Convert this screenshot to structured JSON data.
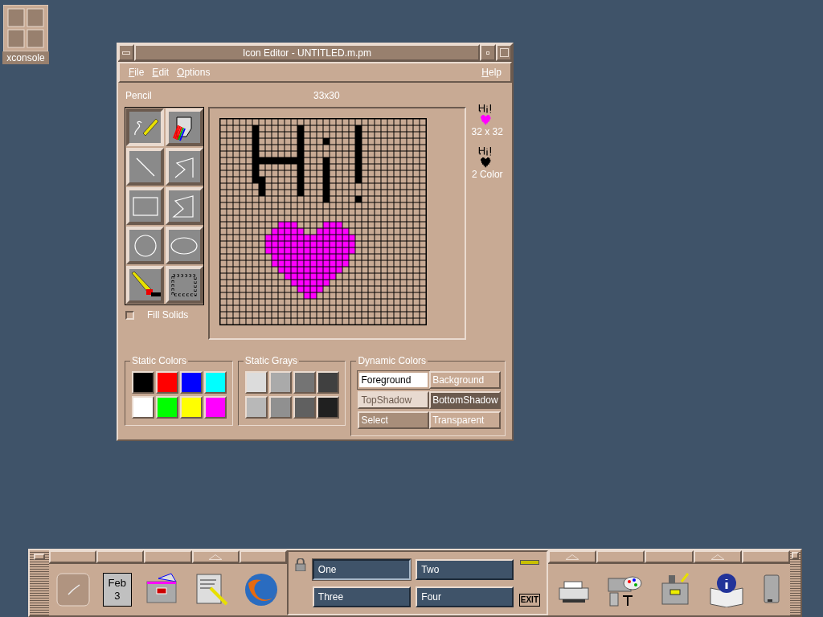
{
  "desktop_icons": [
    {
      "label": "xconsole"
    }
  ],
  "window": {
    "title": "Icon Editor - UNTITLED.m.pm",
    "menus": [
      {
        "key": "F",
        "rest": "ile"
      },
      {
        "key": "E",
        "rest": "dit"
      },
      {
        "key": "O",
        "rest": "ptions"
      },
      {
        "key": "H",
        "rest": "elp"
      }
    ],
    "status": {
      "tool": "Pencil",
      "position": "33x30"
    },
    "tools": [
      {
        "kind": "pencil",
        "selected": true
      },
      {
        "kind": "flood",
        "selected": false
      },
      {
        "kind": "line",
        "selected": false
      },
      {
        "kind": "polyline",
        "selected": false
      },
      {
        "kind": "rectangle",
        "selected": false
      },
      {
        "kind": "polygon",
        "selected": false
      },
      {
        "kind": "circle",
        "selected": false
      },
      {
        "kind": "ellipse",
        "selected": false
      },
      {
        "kind": "eraser",
        "selected": false
      },
      {
        "kind": "select",
        "selected": false
      }
    ],
    "fill_solids": {
      "label": "Fill Solids",
      "checked": false
    },
    "previews": [
      {
        "kind": "color",
        "label": "32 x 32"
      },
      {
        "kind": "mono",
        "label": "2 Color"
      }
    ],
    "static_colors": {
      "title": "Static Colors",
      "swatches": [
        {
          "color": "#000000"
        },
        {
          "color": "#ff0000"
        },
        {
          "color": "#0000ff"
        },
        {
          "color": "#00ffff"
        },
        {
          "color": "#ffffff"
        },
        {
          "color": "#00ff00"
        },
        {
          "color": "#ffff00"
        },
        {
          "color": "#ff00ff"
        }
      ]
    },
    "static_grays": {
      "title": "Static Grays",
      "swatches": [
        {
          "color": "#dcdcdc"
        },
        {
          "color": "#aaaaaa"
        },
        {
          "color": "#747474"
        },
        {
          "color": "#404040"
        },
        {
          "color": "#b8b8b8"
        },
        {
          "color": "#909090"
        },
        {
          "color": "#606060"
        },
        {
          "color": "#202020"
        }
      ]
    },
    "dynamic_colors": {
      "title": "Dynamic Colors",
      "buttons": [
        {
          "label": "Foreground",
          "color": "#ffffff",
          "selected": true
        },
        {
          "label": "Background",
          "color": "#c8aa94",
          "selected": false
        },
        {
          "label": "TopShadow",
          "color": "#e8dad0",
          "selected": false
        },
        {
          "label": "BottomShadow",
          "color": "#6b5a4e",
          "selected": false
        },
        {
          "label": "Select",
          "color": "#a88e7a",
          "selected": false
        },
        {
          "label": "Transparent",
          "color": "#c8aa94",
          "selected": false
        }
      ]
    }
  },
  "front_panel": {
    "date": {
      "month": "Feb",
      "day": "3"
    },
    "workspaces": [
      {
        "label": "One",
        "selected": true
      },
      {
        "label": "Two",
        "selected": false
      },
      {
        "label": "Three",
        "selected": false
      },
      {
        "label": "Four",
        "selected": false
      }
    ],
    "exit_label": "EXIT"
  }
}
